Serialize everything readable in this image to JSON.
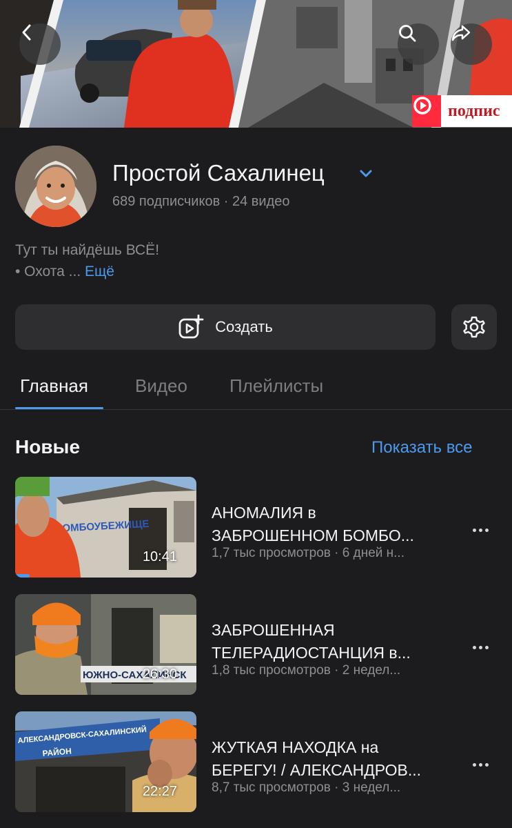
{
  "banner": {
    "subscribe_badge_text": "подпис"
  },
  "icons": {
    "back": "chevron-left-icon",
    "search": "search-icon",
    "share": "share-icon",
    "verified_chevron": "chevron-down-icon",
    "create": "add-video-icon",
    "settings": "gear-icon",
    "more": "more-horizontal-icon"
  },
  "channel": {
    "name": "Простой Сахалинец",
    "subscribers": "689 подписчиков",
    "separator": " · ",
    "videos_count": "24 видео",
    "description_line1": "Тут ты найдёшь ВСЁ!",
    "description_line2": "• Охота ... ",
    "more_label": "Ещё"
  },
  "actions": {
    "create_label": "Создать"
  },
  "tabs": [
    {
      "label": "Главная",
      "active": true
    },
    {
      "label": "Видео",
      "active": false
    },
    {
      "label": "Плейлисты",
      "active": false
    }
  ],
  "section": {
    "title": "Новые",
    "show_all": "Показать все"
  },
  "videos": [
    {
      "title_line1": "АНОМАЛИЯ в",
      "title_line2": "ЗАБРОШЕННОМ БОМБО...",
      "meta": "1,7 тыс просмотров · 6 дней н...",
      "duration": "10:41",
      "thumb_text": "БОМБОУБЕЖИЩЕ",
      "watch_progress": 0.08
    },
    {
      "title_line1": "ЗАБРОШЕННАЯ",
      "title_line2": "ТЕЛЕРАДИОСТАНЦИЯ в...",
      "meta": "1,8 тыс просмотров · 2 недел...",
      "duration": "26:30",
      "thumb_text": "ЮЖНО-САХАЛИНСК",
      "watch_progress": 0
    },
    {
      "title_line1": "ЖУТКАЯ НАХОДКА на",
      "title_line2": "БЕРЕГУ! / АЛЕКСАНДРОВ...",
      "meta": "8,7 тыс просмотров · 3 недел...",
      "duration": "22:27",
      "thumb_text_line1": "АЛЕКСАНДРОВСК-САХАЛИНСКИЙ",
      "thumb_text_line2": "РАЙОН",
      "watch_progress": 0
    }
  ],
  "colors": {
    "background": "#1c1c1e",
    "surface": "#2e2e31",
    "accent": "#4c9aef",
    "muted_text": "#8e8e93"
  }
}
